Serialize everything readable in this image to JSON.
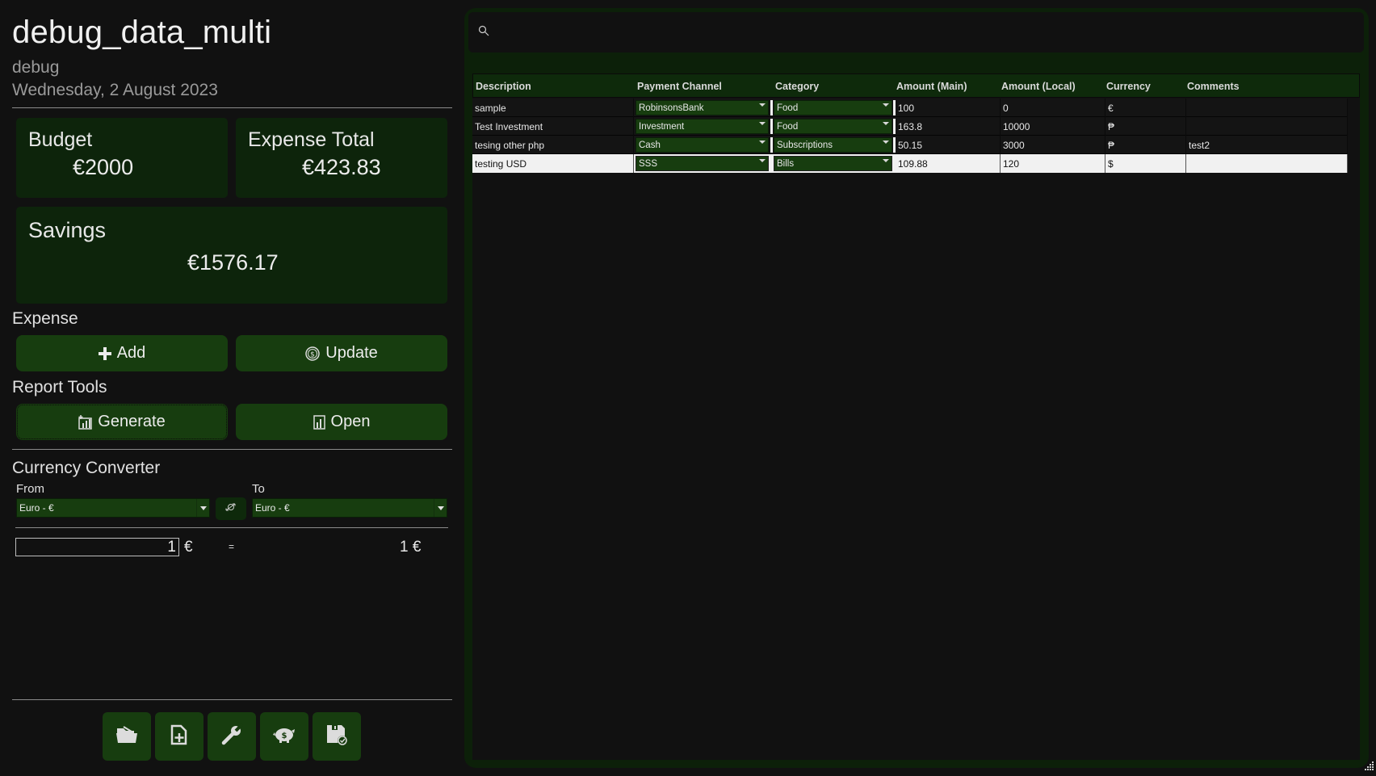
{
  "header": {
    "title": "debug_data_multi",
    "subtitle": "debug",
    "date": "Wednesday, 2 August 2023"
  },
  "summary": {
    "budget": {
      "label": "Budget",
      "value": "€2000"
    },
    "expense_total": {
      "label": "Expense Total",
      "value": "€423.83"
    },
    "savings": {
      "label": "Savings",
      "value": "€1576.17"
    }
  },
  "expense": {
    "section_label": "Expense",
    "add_label": "Add",
    "update_label": "Update"
  },
  "report_tools": {
    "section_label": "Report Tools",
    "generate_label": "Generate",
    "open_label": "Open"
  },
  "currency_converter": {
    "section_label": "Currency Converter",
    "from_label": "From",
    "to_label": "To",
    "from_value": "Euro - €",
    "to_value": "Euro - €",
    "amount_input": "1",
    "input_symbol": "€",
    "equals": "=",
    "result": "1 €"
  },
  "toolbar": {
    "icons": [
      "open-folder-icon",
      "new-file-icon",
      "wrench-icon",
      "piggy-bank-icon",
      "save-icon"
    ]
  },
  "search": {
    "placeholder": "",
    "value": ""
  },
  "table": {
    "columns": [
      "Description",
      "Payment Channel",
      "Category",
      "Amount (Main)",
      "Amount (Local)",
      "Currency",
      "Comments"
    ],
    "rows": [
      {
        "description": "sample",
        "payment_channel": "RobinsonsBank",
        "category": "Food",
        "amount_main": "100",
        "amount_local": "0",
        "currency": "€",
        "comments": ""
      },
      {
        "description": "Test Investment",
        "payment_channel": "Investment",
        "category": "Food",
        "amount_main": "163.8",
        "amount_local": "10000",
        "currency": "₱",
        "comments": ""
      },
      {
        "description": "tesing other php",
        "payment_channel": "Cash",
        "category": "Subscriptions",
        "amount_main": "50.15",
        "amount_local": "3000",
        "currency": "₱",
        "comments": "test2"
      },
      {
        "description": "testing USD",
        "payment_channel": "SSS",
        "category": "Bills",
        "amount_main": "109.88",
        "amount_local": "120",
        "currency": "$",
        "comments": ""
      }
    ],
    "selected_row": 3
  },
  "colors": {
    "background": "#111111",
    "card": "#0d240b",
    "button": "#173d0f",
    "frame": "#0c2009"
  }
}
